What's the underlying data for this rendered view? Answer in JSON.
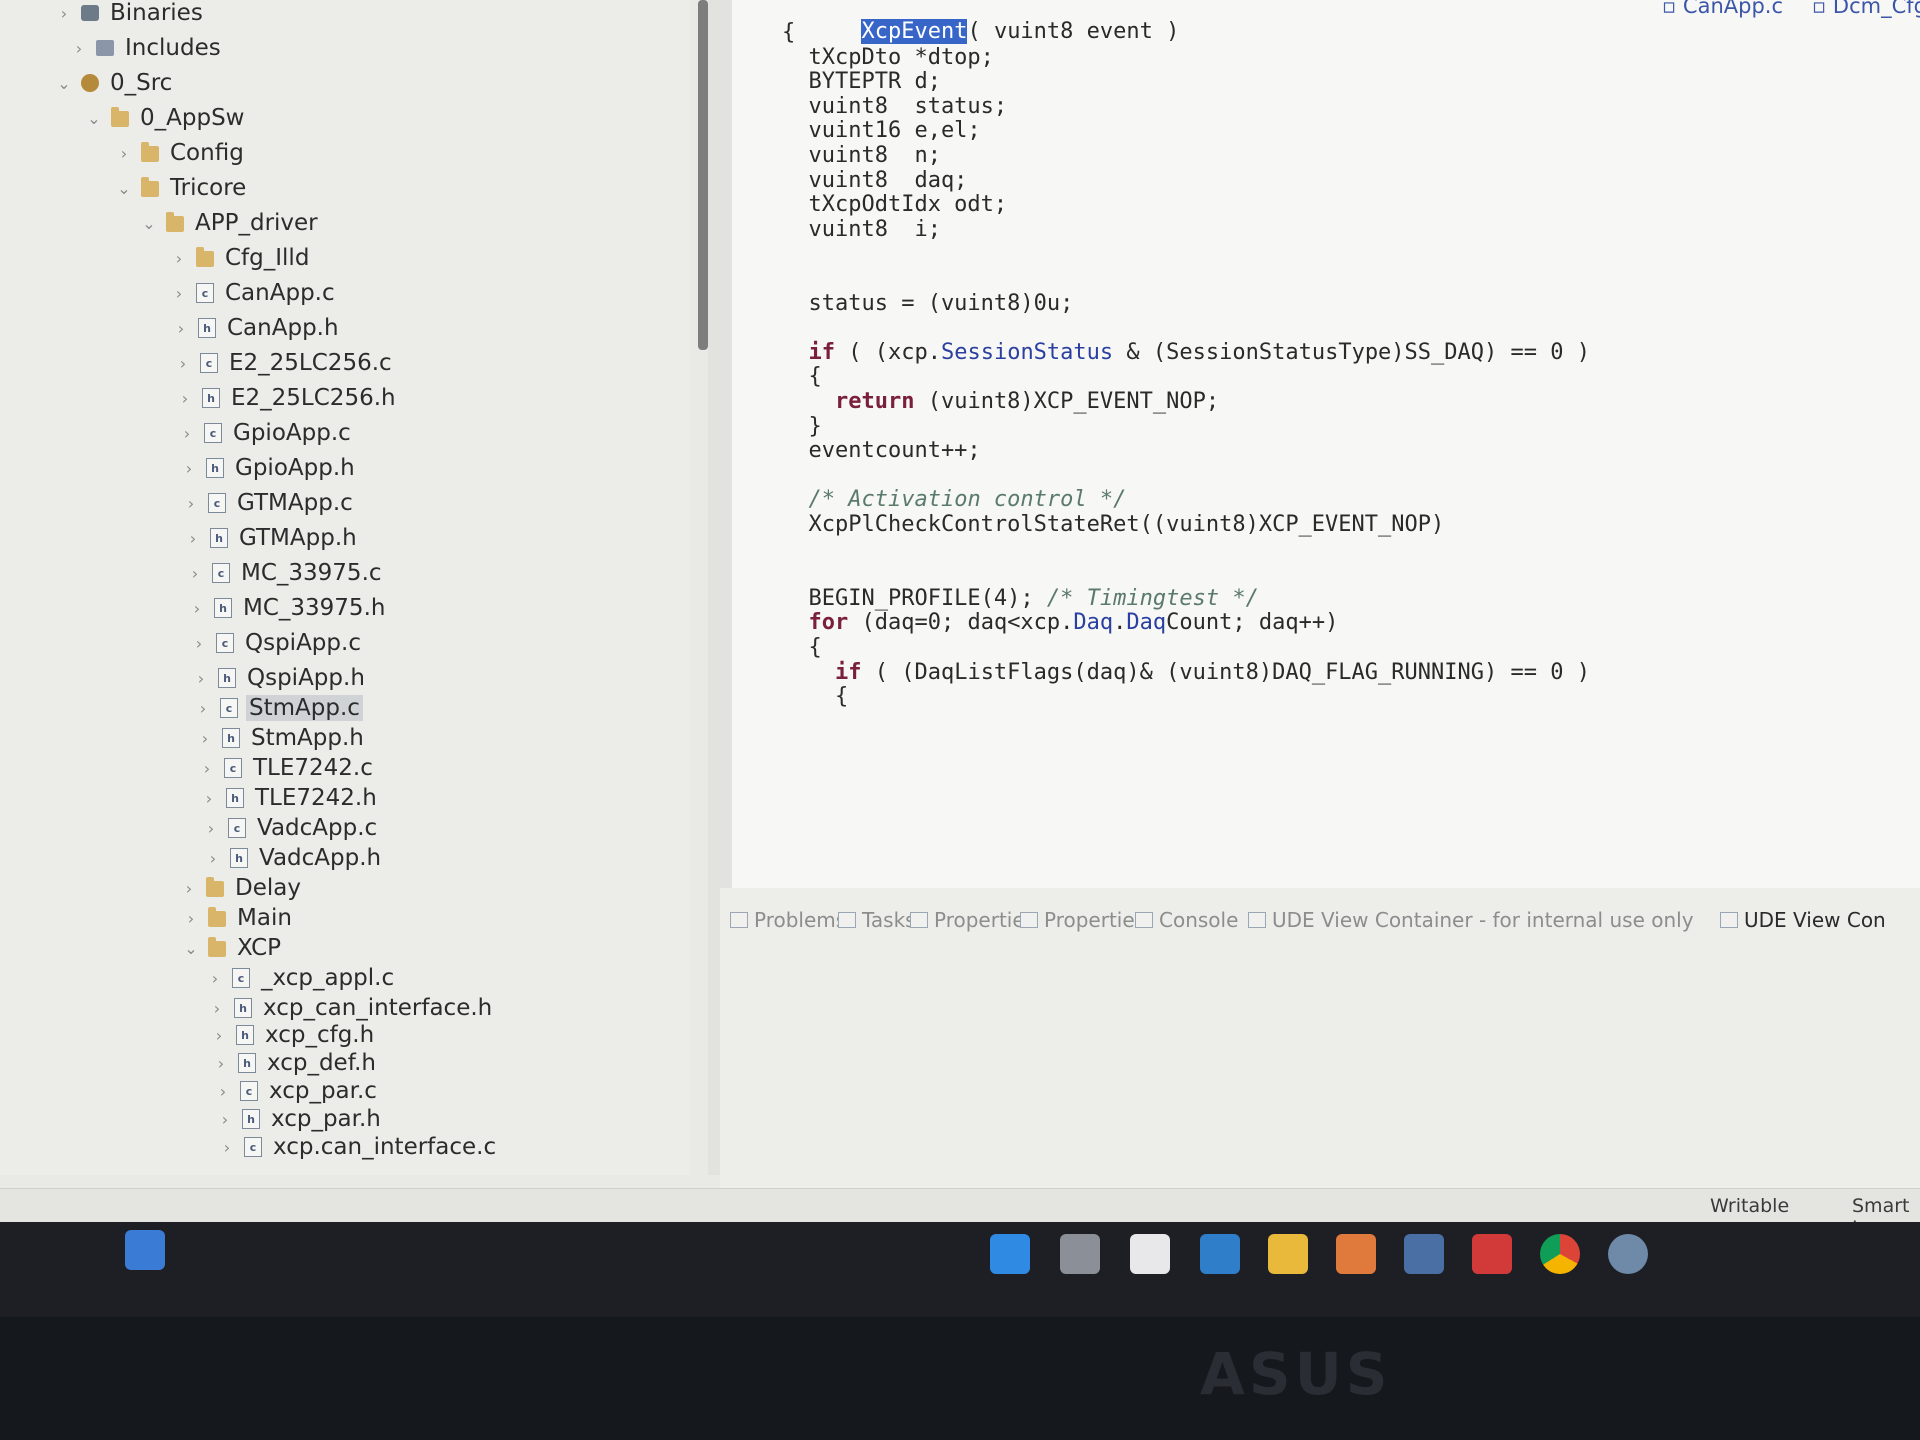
{
  "explorer": {
    "items": [
      {
        "label": "Binaries",
        "icon": "binaries-icon",
        "chevron": ">"
      },
      {
        "label": "Includes",
        "icon": "includes-icon",
        "chevron": ">"
      },
      {
        "label": "0_Src",
        "icon": "source-folder-icon",
        "chevron": "v"
      },
      {
        "label": "0_AppSw",
        "icon": "folder-icon",
        "chevron": "v"
      },
      {
        "label": "Config",
        "icon": "folder-icon",
        "chevron": ">"
      },
      {
        "label": "Tricore",
        "icon": "folder-icon",
        "chevron": "v"
      },
      {
        "label": "APP_driver",
        "icon": "folder-icon",
        "chevron": "v"
      },
      {
        "label": "Cfg_Illd",
        "icon": "folder-icon",
        "chevron": ">"
      },
      {
        "label": "CanApp.c",
        "icon": "c-file-icon",
        "chevron": ">"
      },
      {
        "label": "CanApp.h",
        "icon": "h-file-icon",
        "chevron": ">"
      },
      {
        "label": "E2_25LC256.c",
        "icon": "c-file-icon",
        "chevron": ">"
      },
      {
        "label": "E2_25LC256.h",
        "icon": "h-file-icon",
        "chevron": ">"
      },
      {
        "label": "GpioApp.c",
        "icon": "c-file-icon",
        "chevron": ">"
      },
      {
        "label": "GpioApp.h",
        "icon": "h-file-icon",
        "chevron": ">"
      },
      {
        "label": "GTMApp.c",
        "icon": "c-file-icon",
        "chevron": ">"
      },
      {
        "label": "GTMApp.h",
        "icon": "h-file-icon",
        "chevron": ">"
      },
      {
        "label": "MC_33975.c",
        "icon": "c-file-icon",
        "chevron": ">"
      },
      {
        "label": "MC_33975.h",
        "icon": "h-file-icon",
        "chevron": ">"
      },
      {
        "label": "QspiApp.c",
        "icon": "c-file-icon",
        "chevron": ">"
      },
      {
        "label": "QspiApp.h",
        "icon": "h-file-icon",
        "chevron": ">"
      },
      {
        "label": "StmApp.c",
        "icon": "c-file-icon",
        "chevron": ">",
        "selected": true
      },
      {
        "label": "StmApp.h",
        "icon": "h-file-icon",
        "chevron": ">"
      },
      {
        "label": "TLE7242.c",
        "icon": "c-file-icon",
        "chevron": ">"
      },
      {
        "label": "TLE7242.h",
        "icon": "h-file-icon",
        "chevron": ">"
      },
      {
        "label": "VadcApp.c",
        "icon": "c-file-icon",
        "chevron": ">"
      },
      {
        "label": "VadcApp.h",
        "icon": "h-file-icon",
        "chevron": ">"
      },
      {
        "label": "Delay",
        "icon": "folder-icon",
        "chevron": ">"
      },
      {
        "label": "Main",
        "icon": "folder-icon",
        "chevron": ">"
      },
      {
        "label": "XCP",
        "icon": "folder-icon",
        "chevron": "v"
      },
      {
        "label": "_xcp_appl.c",
        "icon": "c-file-icon",
        "chevron": ">"
      },
      {
        "label": "xcp_can_interface.h",
        "icon": "h-file-icon",
        "chevron": ">"
      },
      {
        "label": "xcp_cfg.h",
        "icon": "h-file-icon",
        "chevron": ">"
      },
      {
        "label": "xcp_def.h",
        "icon": "h-file-icon",
        "chevron": ">"
      },
      {
        "label": "xcp_par.c",
        "icon": "c-file-icon",
        "chevron": ">"
      },
      {
        "label": "xcp_par.h",
        "icon": "h-file-icon",
        "chevron": ">"
      },
      {
        "label": "xcp.can_interface.c",
        "icon": "c-file-icon",
        "chevron": ">"
      }
    ]
  },
  "editor": {
    "top_tabs": [
      "CanApp.c",
      "Dcm_Cfg"
    ],
    "header_line": {
      "pre": "XcpEvent",
      "post": "( vuint8 event )"
    },
    "lines": [
      "{",
      "  tXcpDto *dtop;",
      "  BYTEPTR d;",
      "  vuint8  status;",
      "  vuint16 e,el;",
      "  vuint8  n;",
      "  vuint8  daq;",
      "  tXcpOdtIdx odt;",
      "  vuint8  i;",
      "",
      "",
      "  status = (vuint8)0u;",
      "",
      "  if ( (xcp.SessionStatus & (SessionStatusType)SS_DAQ) == 0 )",
      "  {",
      "    return (vuint8)XCP_EVENT_NOP;",
      "  }",
      "  eventcount++;",
      "",
      "  /* Activation control */",
      "  XcpPlCheckControlStateRet((vuint8)XCP_EVENT_NOP)",
      "",
      "",
      "  BEGIN_PROFILE(4); /* Timingtest */",
      "  for (daq=0; daq<xcp.Daq.DaqCount; daq++)",
      "  {",
      "    if ( (DaqListFlags(daq)& (vuint8)DAQ_FLAG_RUNNING) == 0 )",
      "    {"
    ]
  },
  "views": {
    "tabs": [
      {
        "label": "Problems",
        "active": false
      },
      {
        "label": "Tasks",
        "active": false
      },
      {
        "label": "Properties",
        "active": false
      },
      {
        "label": "Properties",
        "active": false
      },
      {
        "label": "Console",
        "active": false
      },
      {
        "label": "UDE View Container - for internal use only",
        "active": false
      },
      {
        "label": "UDE View Con",
        "active": true
      }
    ]
  },
  "status": {
    "mode": "Writable",
    "insert": "Smart Ir"
  },
  "taskbar": {
    "icons": [
      "start-icon",
      "task-view-icon",
      "store-icon",
      "mail-icon",
      "file-explorer-icon",
      "app-icon",
      "calculator-icon",
      "office-icon",
      "chrome-icon",
      "ide-icon"
    ]
  },
  "monitor_brand": "ASUS",
  "colors": {
    "keyword": "#7a1f3d",
    "field": "#2a3fa0",
    "comment": "#5a7a6a",
    "selection": "#3866c8"
  }
}
